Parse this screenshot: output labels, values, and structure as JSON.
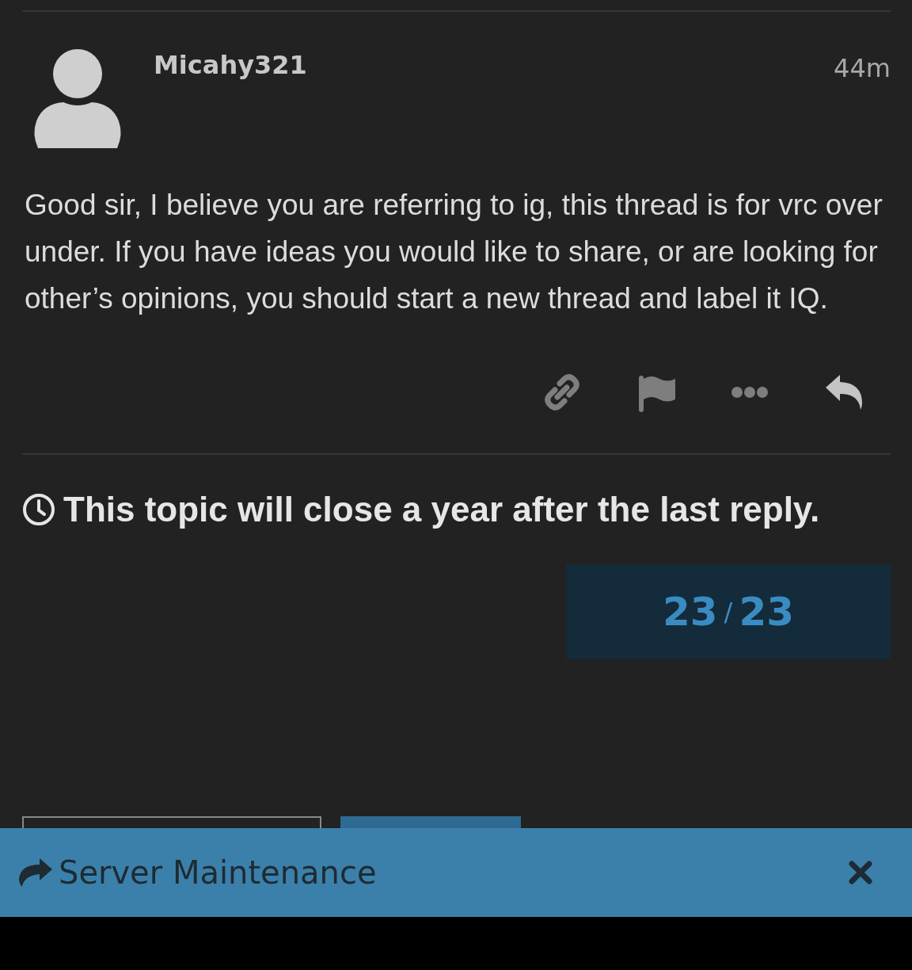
{
  "post": {
    "username": "Micahy321",
    "time": "44m",
    "body": "Good sir, I believe you are referring to ig, this thread is for vrc over under. If you have ideas you would like to share, or are looking for other’s opinions, you should start a new thread and label it IQ."
  },
  "notice": "This topic will close a year after the last reply.",
  "progress": {
    "current": "23",
    "separator": "/",
    "total": "23"
  },
  "banner": {
    "title": "Server Maintenance"
  }
}
